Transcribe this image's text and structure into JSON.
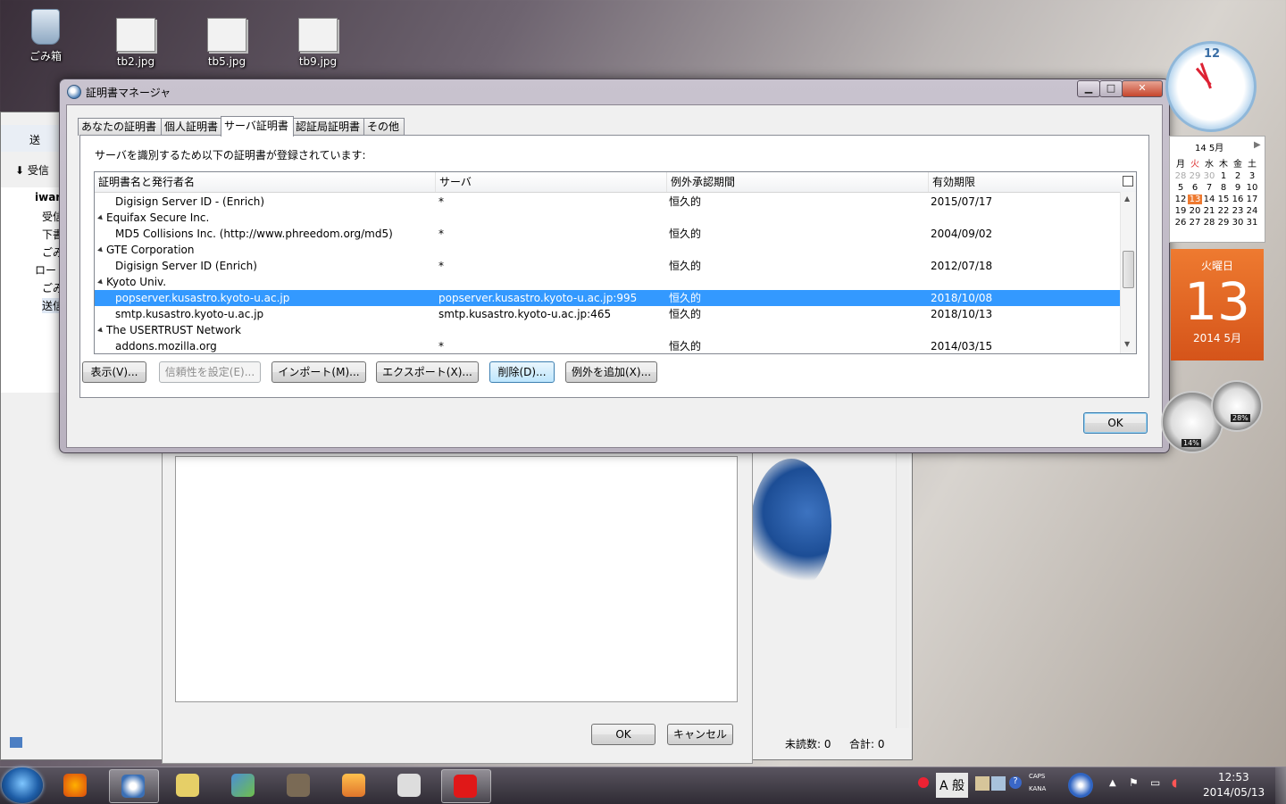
{
  "desktop": {
    "icons": [
      {
        "label": "ごみ箱"
      },
      {
        "label": "tb2.jpg"
      },
      {
        "label": "tb5.jpg"
      },
      {
        "label": "tb9.jpg"
      }
    ]
  },
  "mail_window": {
    "toolbar_send": "送",
    "toolbar_receive": "受信",
    "sidebar": [
      "iwar",
      "受信",
      "下書",
      "ごみ",
      "ロー",
      "ごみ",
      "送信"
    ],
    "ok": "OK",
    "cancel": "キャンセル",
    "unread_label": "未読数: 0",
    "total_label": "合計: 0"
  },
  "dialog": {
    "title": "証明書マネージャ",
    "caption_buttons": {
      "minimize": "▁",
      "maximize": "□",
      "close": "✕"
    },
    "tabs": [
      {
        "label": "あなたの証明書",
        "active": false
      },
      {
        "label": "個人証明書",
        "active": false
      },
      {
        "label": "サーバ証明書",
        "active": true
      },
      {
        "label": "認証局証明書",
        "active": false
      },
      {
        "label": "その他",
        "active": false
      }
    ],
    "description": "サーバを識別するため以下の証明書が登録されています:",
    "columns": [
      "証明書名と発行者名",
      "サーバ",
      "例外承認期間",
      "有効期限"
    ],
    "rows": [
      {
        "group": false,
        "name": "Digisign Server ID - (Enrich)",
        "server": "*",
        "period": "恒久的",
        "expires": "2015/07/17",
        "selected": false
      },
      {
        "group": true,
        "name": "Equifax Secure Inc.",
        "server": "",
        "period": "",
        "expires": "",
        "selected": false
      },
      {
        "group": false,
        "name": "MD5 Collisions Inc. (http://www.phreedom.org/md5)",
        "server": "*",
        "period": "恒久的",
        "expires": "2004/09/02",
        "selected": false
      },
      {
        "group": true,
        "name": "GTE Corporation",
        "server": "",
        "period": "",
        "expires": "",
        "selected": false
      },
      {
        "group": false,
        "name": "Digisign Server ID (Enrich)",
        "server": "*",
        "period": "恒久的",
        "expires": "2012/07/18",
        "selected": false
      },
      {
        "group": true,
        "name": "Kyoto Univ.",
        "server": "",
        "period": "",
        "expires": "",
        "selected": false
      },
      {
        "group": false,
        "name": "popserver.kusastro.kyoto-u.ac.jp",
        "server": "popserver.kusastro.kyoto-u.ac.jp:995",
        "period": "恒久的",
        "expires": "2018/10/08",
        "selected": true
      },
      {
        "group": false,
        "name": "smtp.kusastro.kyoto-u.ac.jp",
        "server": "smtp.kusastro.kyoto-u.ac.jp:465",
        "period": "恒久的",
        "expires": "2018/10/13",
        "selected": false
      },
      {
        "group": true,
        "name": "The USERTRUST Network",
        "server": "",
        "period": "",
        "expires": "",
        "selected": false
      },
      {
        "group": false,
        "name": "addons.mozilla.org",
        "server": "*",
        "period": "恒久的",
        "expires": "2014/03/15",
        "selected": false
      }
    ],
    "buttons": {
      "view": "表示(V)...",
      "trust": "信頼性を設定(E)...",
      "import": "インポート(M)...",
      "export": "エクスポート(X)...",
      "delete": "削除(D)...",
      "add_exception": "例外を追加(X)..."
    },
    "ok": "OK"
  },
  "gadgets": {
    "clock_number": "12",
    "calendar_header": "14 5月",
    "calendar_weekdays": [
      "月",
      "火",
      "水",
      "木",
      "金",
      "土"
    ],
    "calendar_rows": [
      [
        "28",
        "29",
        "30",
        "1",
        "2",
        "3"
      ],
      [
        "5",
        "6",
        "7",
        "8",
        "9",
        "10"
      ],
      [
        "12",
        "13",
        "14",
        "15",
        "16",
        "17"
      ],
      [
        "19",
        "20",
        "21",
        "22",
        "23",
        "24"
      ],
      [
        "26",
        "27",
        "28",
        "29",
        "30",
        "31"
      ]
    ],
    "weekday": "火曜日",
    "day": "13",
    "month_year": "2014 5月",
    "cpu_percent": "14%",
    "mem_percent": "28%"
  },
  "taskbar": {
    "ime": "A 般",
    "caps": "CAPS",
    "kana": "KANA",
    "time": "12:53",
    "date": "2014/05/13"
  }
}
